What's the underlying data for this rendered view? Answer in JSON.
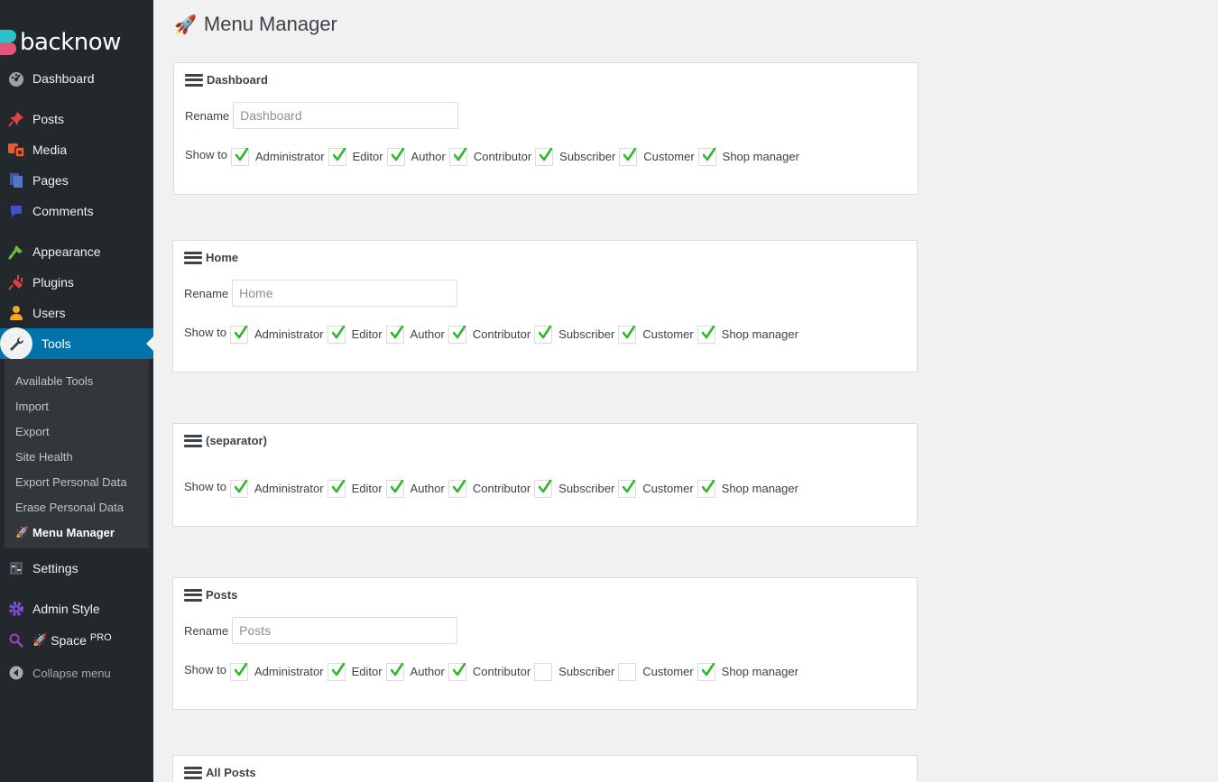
{
  "brand": {
    "name": "backnow"
  },
  "sidebar": {
    "items": [
      {
        "label": "Dashboard",
        "icon": "dashboard-icon"
      },
      {
        "label": "Posts",
        "icon": "pushpin-icon"
      },
      {
        "label": "Media",
        "icon": "media-icon"
      },
      {
        "label": "Pages",
        "icon": "pages-icon"
      },
      {
        "label": "Comments",
        "icon": "comments-icon"
      },
      {
        "label": "Appearance",
        "icon": "brush-icon"
      },
      {
        "label": "Plugins",
        "icon": "plug-icon"
      },
      {
        "label": "Users",
        "icon": "user-icon"
      },
      {
        "label": "Tools",
        "icon": "wrench-icon"
      },
      {
        "label": "Settings",
        "icon": "settings-icon"
      },
      {
        "label": "Admin Style",
        "icon": "gear-icon"
      },
      {
        "label": "Space",
        "sup": "PRO",
        "icon": "search-icon"
      },
      {
        "label": "Collapse menu",
        "icon": "collapse-icon"
      }
    ],
    "submenu": [
      {
        "label": "Available Tools"
      },
      {
        "label": "Import"
      },
      {
        "label": "Export"
      },
      {
        "label": "Site Health"
      },
      {
        "label": "Export Personal Data"
      },
      {
        "label": "Erase Personal Data"
      },
      {
        "label": "Menu Manager"
      }
    ]
  },
  "page": {
    "title": "Menu Manager"
  },
  "labels": {
    "rename": "Rename",
    "show_to": "Show to"
  },
  "roles": [
    "Administrator",
    "Editor",
    "Author",
    "Contributor",
    "Subscriber",
    "Customer",
    "Shop manager"
  ],
  "cards": [
    {
      "title": "Dashboard",
      "rename_placeholder": "Dashboard",
      "checked": [
        true,
        true,
        true,
        true,
        true,
        true,
        true
      ]
    },
    {
      "title": "Home",
      "rename_placeholder": "Home",
      "checked": [
        true,
        true,
        true,
        true,
        true,
        true,
        true
      ]
    },
    {
      "title": "(separator)",
      "checked": [
        true,
        true,
        true,
        true,
        true,
        true,
        true
      ]
    },
    {
      "title": "Posts",
      "rename_placeholder": "Posts",
      "checked": [
        true,
        true,
        true,
        true,
        false,
        false,
        true
      ]
    },
    {
      "title": "All Posts"
    }
  ],
  "colors": {
    "sidebar_bg": "#23282d",
    "active_bg": "#0073aa",
    "check_green": "#2fb82a"
  }
}
